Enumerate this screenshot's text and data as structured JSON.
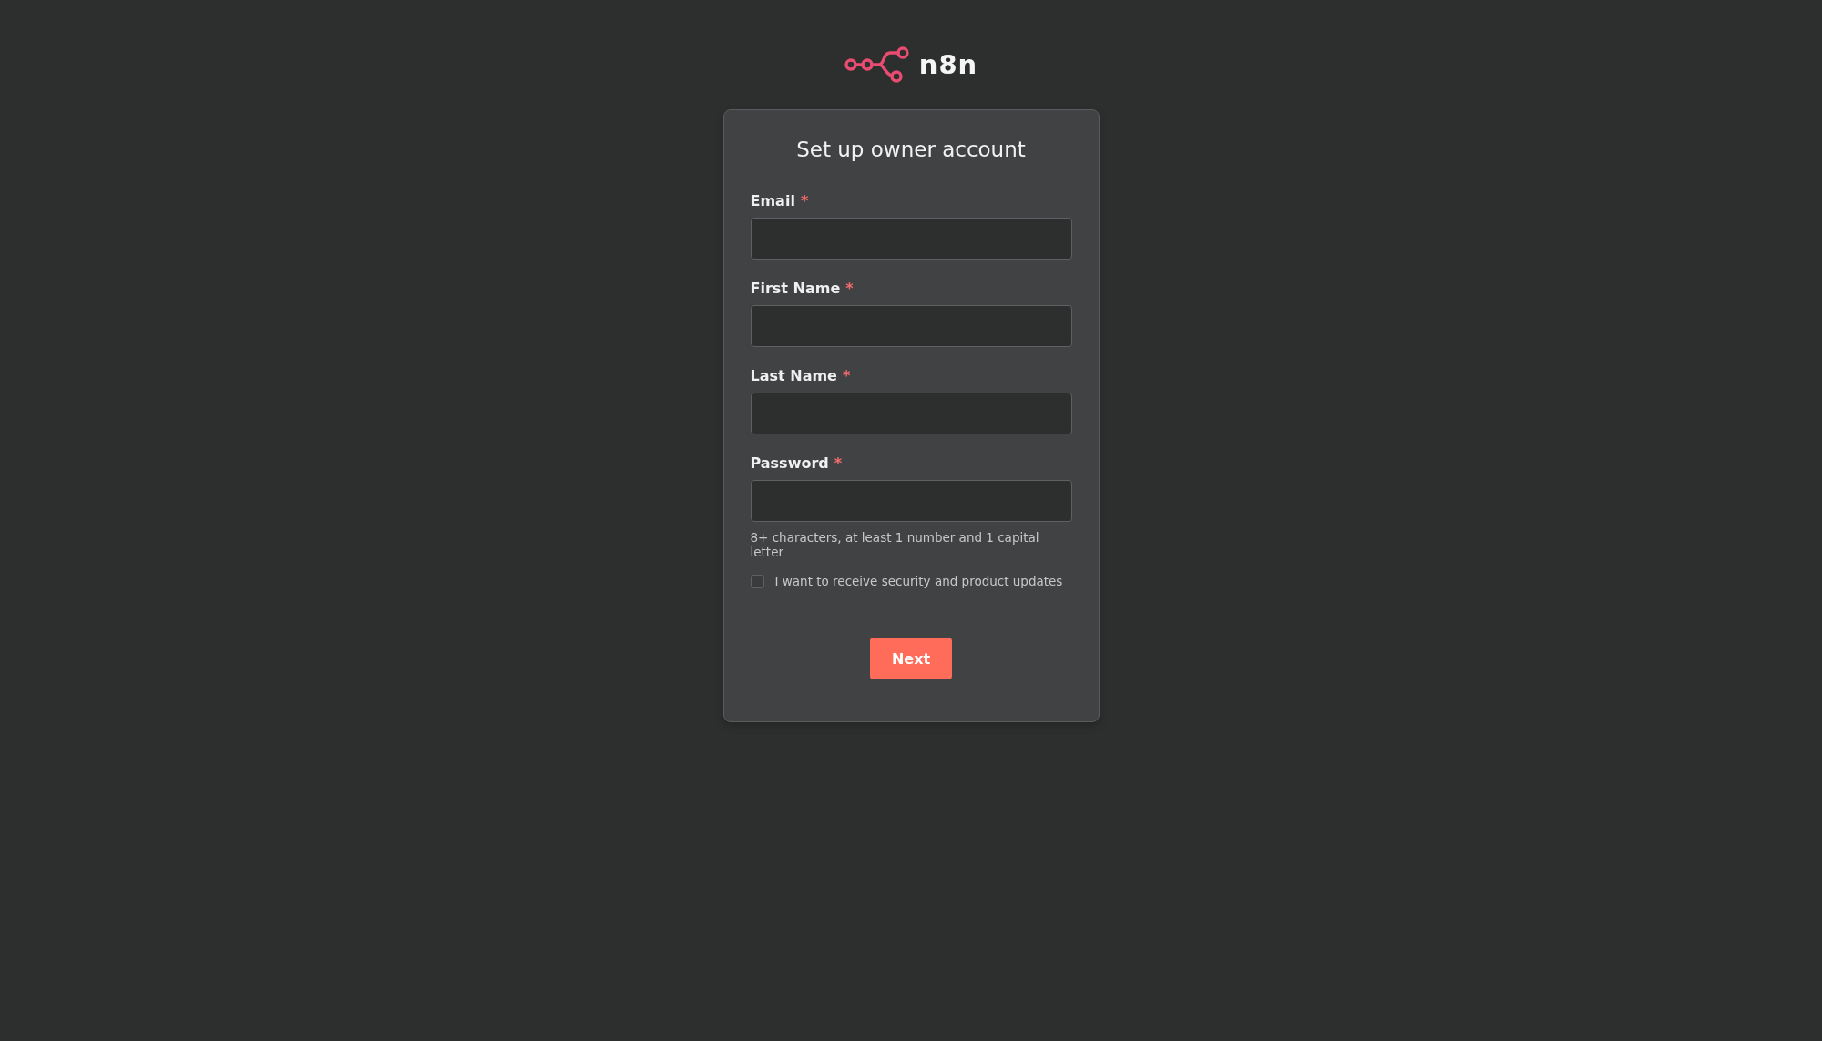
{
  "logo": {
    "text": "n8n"
  },
  "form": {
    "title": "Set up owner account",
    "fields": [
      {
        "label": "Email",
        "required_mark": "*"
      },
      {
        "label": "First Name",
        "required_mark": "*"
      },
      {
        "label": "Last Name",
        "required_mark": "*"
      },
      {
        "label": "Password",
        "required_mark": "*",
        "hint": "8+ characters, at least 1 number and 1 capital letter"
      }
    ],
    "checkbox": {
      "label": "I want to receive security and product updates",
      "checked": false
    },
    "button": "Next"
  }
}
